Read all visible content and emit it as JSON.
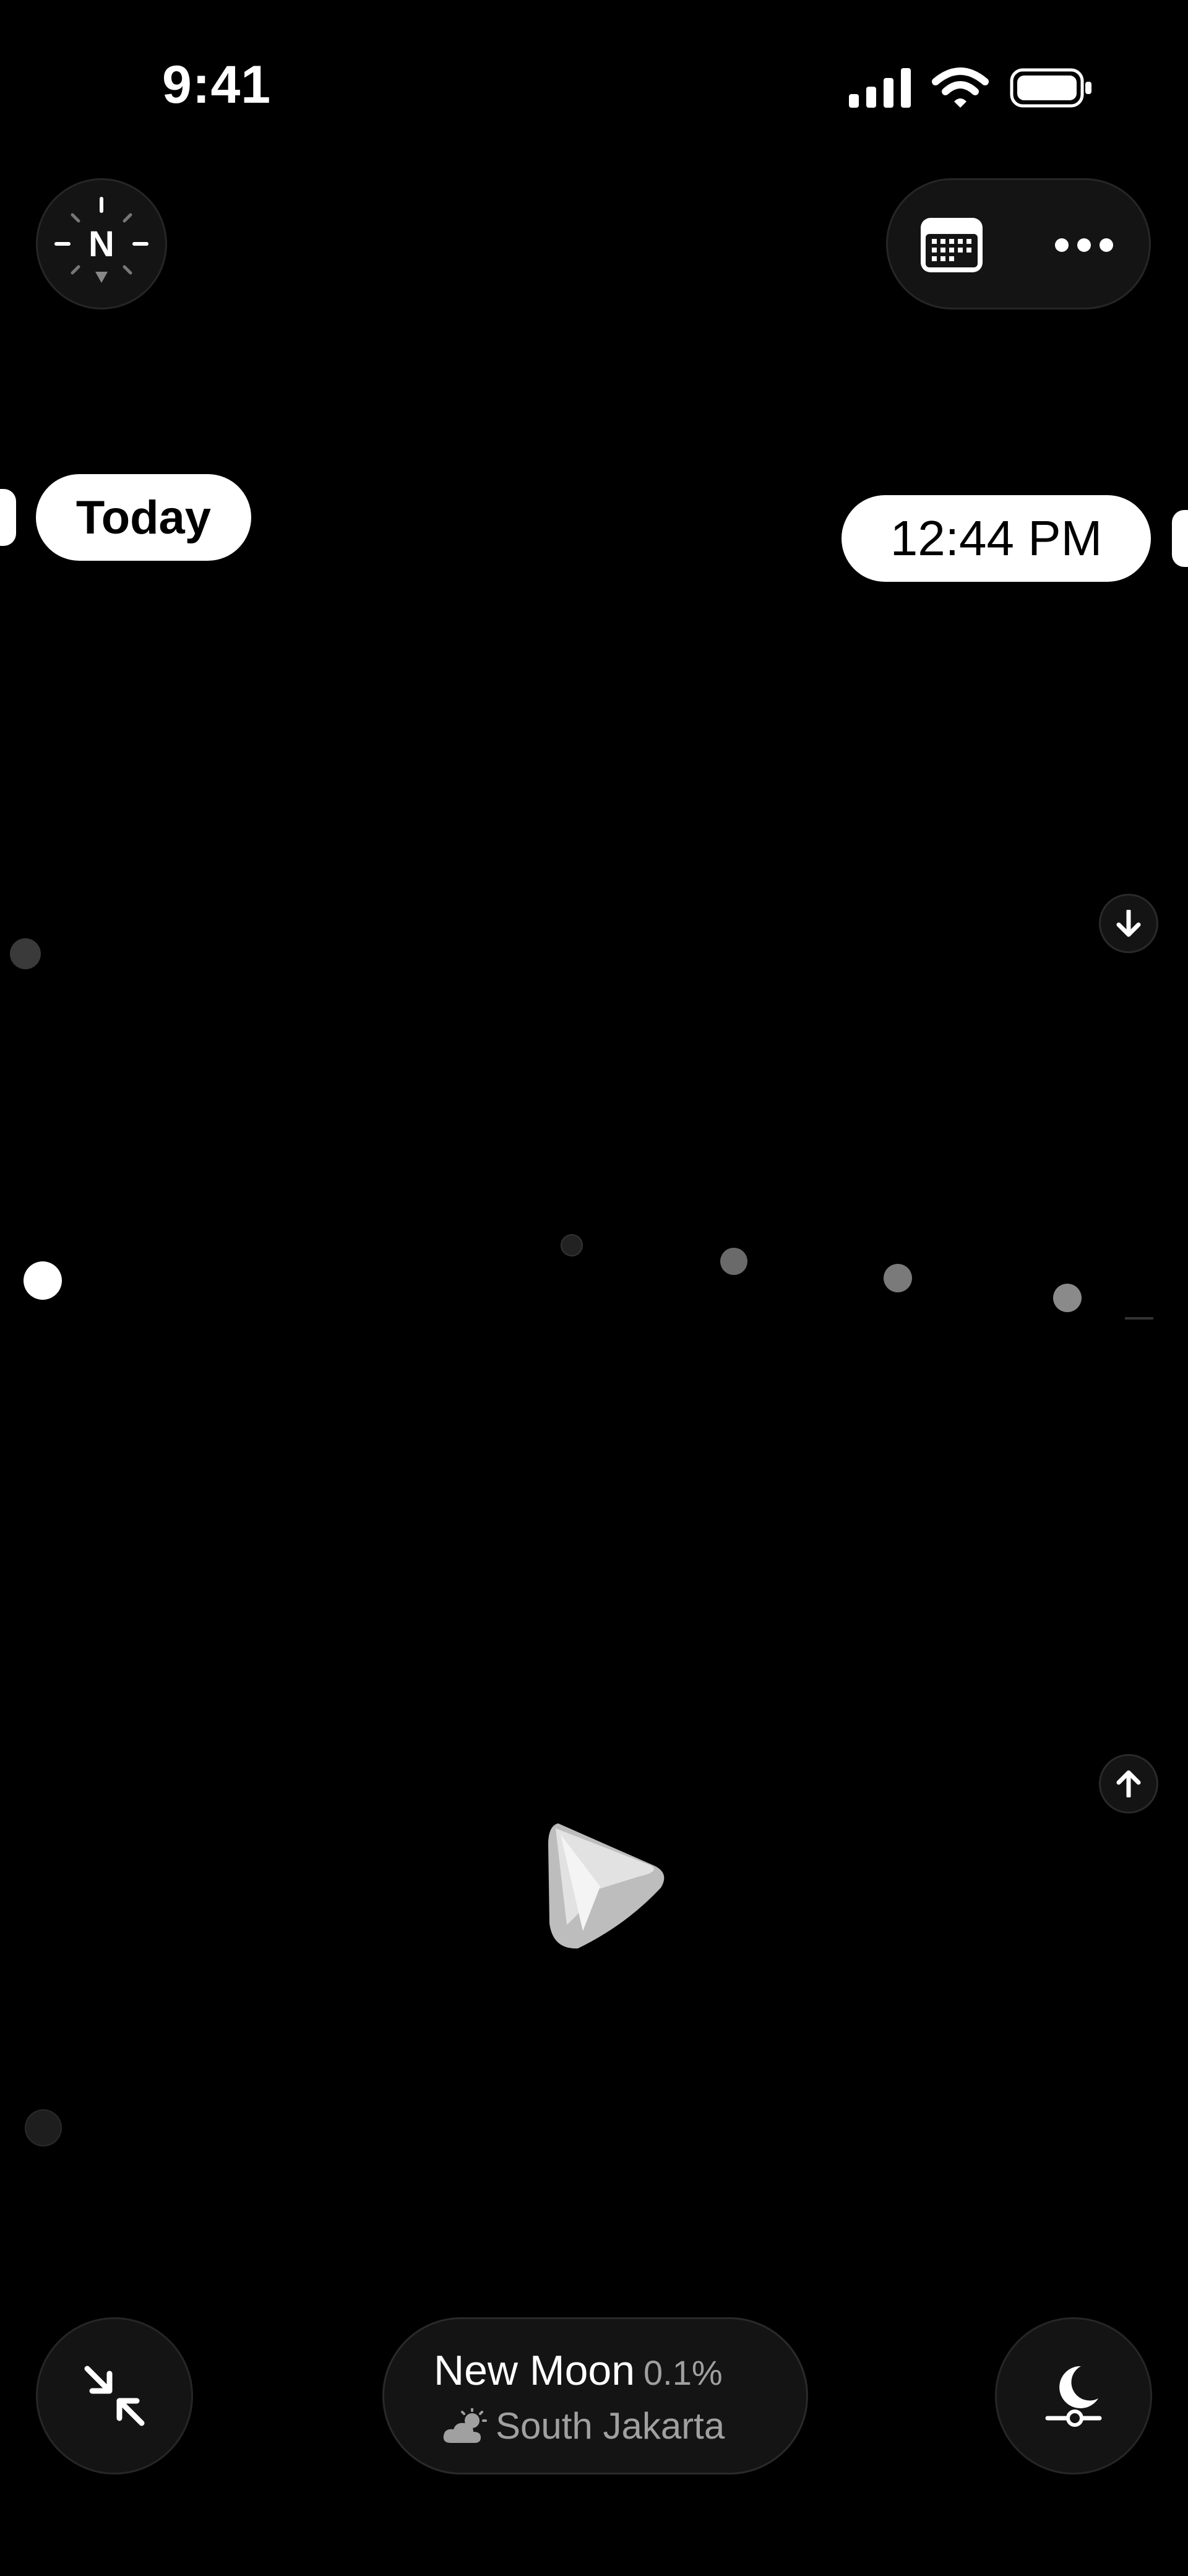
{
  "status_bar": {
    "time": "9:41",
    "icons": [
      "cellular-signal-icon",
      "wifi-icon",
      "battery-icon"
    ]
  },
  "header": {
    "compass": {
      "letter": "N",
      "icon": "compass-icon"
    },
    "actions": [
      {
        "name": "calendar",
        "icon": "calendar-icon"
      },
      {
        "name": "more",
        "icon": "more-horizontal-icon"
      }
    ]
  },
  "timeline": {
    "today_label": "Today",
    "current_time_label": "12:44 PM"
  },
  "moon_info": {
    "phase": "New Moon",
    "illumination": "0.1%",
    "location": "South Jakarta",
    "weather_icon": "partly-cloudy-icon"
  },
  "controls": {
    "collapse_icon": "collapse-arrows-icon",
    "night_mode_icon": "moon-slider-icon",
    "scroll_down_icon": "arrow-down-icon",
    "scroll_up_icon": "arrow-up-icon"
  },
  "colors": {
    "background": "#000000",
    "surface": "#141414",
    "pill": "#ffffff",
    "muted_text": "#a0a0a0"
  }
}
